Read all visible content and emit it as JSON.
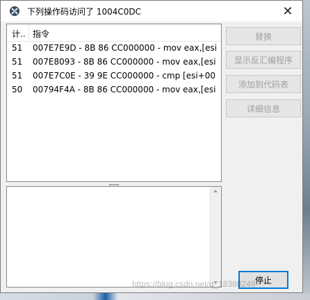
{
  "window": {
    "title": "下列操作码访问了 1004C0DC",
    "close_glyph": "✕"
  },
  "list": {
    "columns": [
      "计..",
      "指令"
    ],
    "rows": [
      {
        "count": "51",
        "instruction": "007E7E9D - 8B 86 CC000000  - mov eax,[esi"
      },
      {
        "count": "51",
        "instruction": "007E8093 - 8B 86 CC000000  - mov eax,[esi"
      },
      {
        "count": "51",
        "instruction": "007E7C0E - 39 9E CC000000  - cmp [esi+00"
      },
      {
        "count": "50",
        "instruction": "00794F4A - 8B 86 CC000000  - mov eax,[esi"
      }
    ]
  },
  "buttons": {
    "replace": "替换",
    "show_disassembler": "显示反汇编程序",
    "add_to_codelist": "添加到代码表",
    "more_info": "详细信息",
    "stop": "停止"
  },
  "watermark": "https://blog.csdn.net/q_18388249"
}
